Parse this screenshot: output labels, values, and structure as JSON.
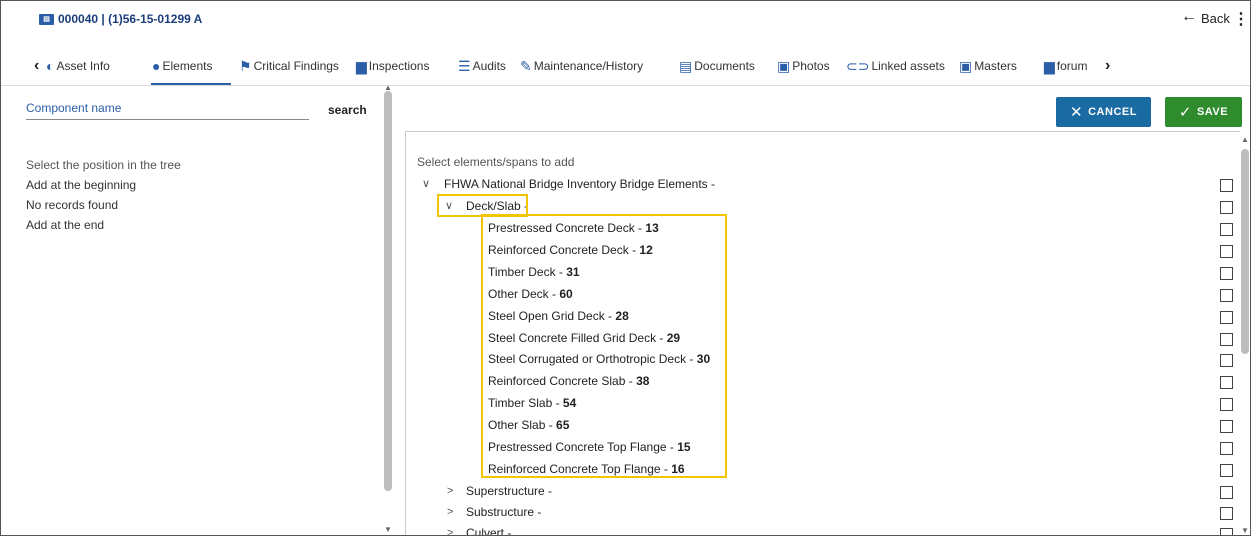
{
  "header": {
    "asset_id": "000040 | (1)56-15-01299 A",
    "back_label": "Back"
  },
  "tabs": [
    {
      "label": "Asset Info",
      "icon": "toggle-icon"
    },
    {
      "label": "Elements",
      "icon": "elements-icon"
    },
    {
      "label": "Critical Findings",
      "icon": "flag-icon"
    },
    {
      "label": "Inspections",
      "icon": "chat-icon"
    },
    {
      "label": "Audits",
      "icon": "list-icon"
    },
    {
      "label": "Maintenance/History",
      "icon": "wrench-icon"
    },
    {
      "label": "Documents",
      "icon": "document-icon"
    },
    {
      "label": "Photos",
      "icon": "photo-icon"
    },
    {
      "label": "Linked assets",
      "icon": "link-icon"
    },
    {
      "label": "Masters",
      "icon": "masters-icon"
    },
    {
      "label": "forum",
      "icon": "forum-icon"
    }
  ],
  "left": {
    "component_label": "Component name",
    "search_label": "search",
    "lines": [
      "Select the position in the tree",
      "Add at the beginning",
      "No records found",
      "Add at the end"
    ]
  },
  "buttons": {
    "cancel": "CANCEL",
    "save": "SAVE"
  },
  "tree": {
    "hint": "Select elements/spans to add",
    "root": "FHWA National Bridge Inventory Bridge Elements -",
    "group": "Deck/Slab -",
    "children": [
      {
        "name": "Prestressed Concrete Deck - ",
        "code": "13"
      },
      {
        "name": "Reinforced Concrete Deck - ",
        "code": "12"
      },
      {
        "name": "Timber Deck - ",
        "code": "31"
      },
      {
        "name": "Other Deck - ",
        "code": "60"
      },
      {
        "name": "Steel Open Grid Deck - ",
        "code": "28"
      },
      {
        "name": "Steel Concrete Filled Grid Deck - ",
        "code": "29"
      },
      {
        "name": "Steel Corrugated or Orthotropic Deck - ",
        "code": "30"
      },
      {
        "name": "Reinforced Concrete Slab - ",
        "code": "38"
      },
      {
        "name": "Timber Slab - ",
        "code": "54"
      },
      {
        "name": "Other Slab - ",
        "code": "65"
      },
      {
        "name": "Prestressed Concrete Top Flange - ",
        "code": "15"
      },
      {
        "name": "Reinforced Concrete Top Flange - ",
        "code": "16"
      }
    ],
    "collapsed": [
      "Superstructure -",
      "Substructure -",
      "Culvert -"
    ]
  }
}
